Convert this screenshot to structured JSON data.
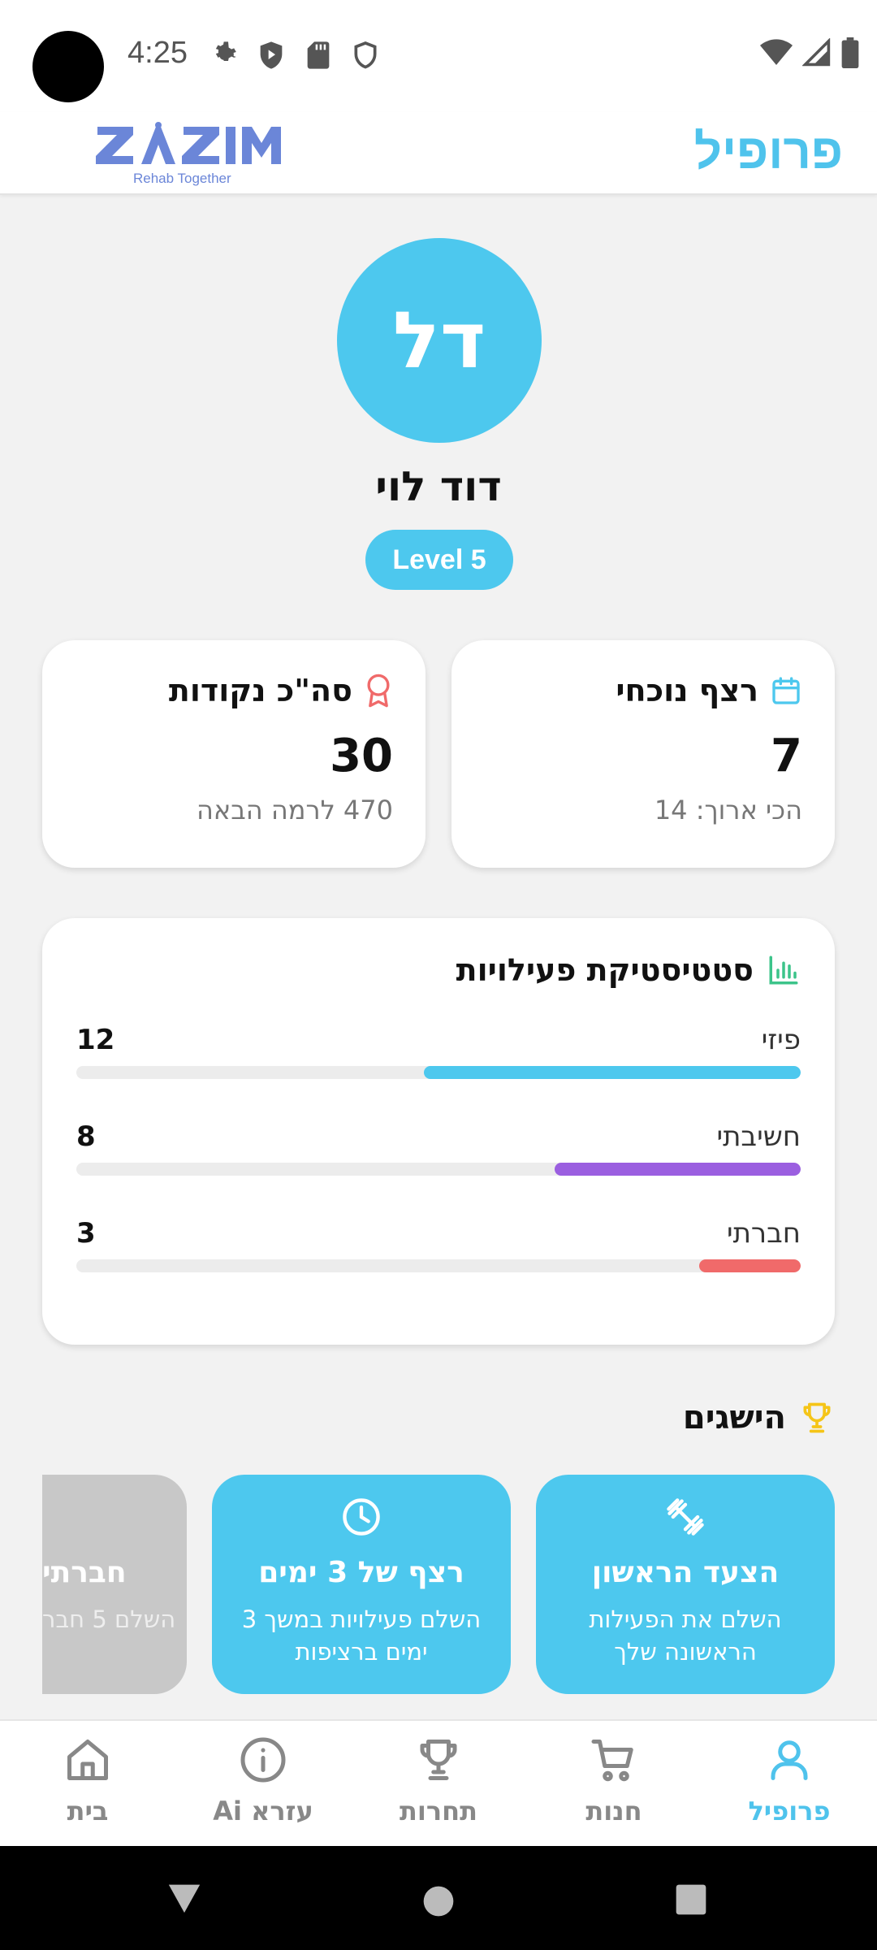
{
  "status_bar": {
    "time": "4:25"
  },
  "header": {
    "logo_text": "ZZIM",
    "logo_subtitle": "Rehab Together",
    "title": "פרופיל"
  },
  "profile": {
    "initials": "דל",
    "name": "דוד לוי",
    "level": "Level 5"
  },
  "stats": {
    "streak": {
      "title": "רצף נוכחי",
      "value": "7",
      "sub": "הכי ארוך: 14"
    },
    "points": {
      "title": "סה\"כ נקודות",
      "value": "30",
      "sub": "470 לרמה הבאה"
    }
  },
  "activity": {
    "title": "סטטיסטיקת פעילויות",
    "rows": [
      {
        "label": "פיזי",
        "count": "12",
        "fraction": 0.52,
        "color": "#4dc8ee"
      },
      {
        "label": "חשיבתי",
        "count": "8",
        "fraction": 0.34,
        "color": "#9b5fe0"
      },
      {
        "label": "חברתי",
        "count": "3",
        "fraction": 0.14,
        "color": "#f06a6a"
      }
    ]
  },
  "achievements": {
    "title": "הישגים",
    "items": [
      {
        "name": "הצעד הראשון",
        "desc": "השלם את הפעילות הראשונה שלך",
        "icon": "dumbbell-icon",
        "locked": false
      },
      {
        "name": "רצף של 3 ימים",
        "desc": "השלם פעילויות במשך 3 ימים ברציפות",
        "icon": "clock-icon",
        "locked": false
      },
      {
        "name": "חברתי",
        "desc": "השלם 5 חבר",
        "icon": "users-icon",
        "locked": true
      }
    ]
  },
  "nav": {
    "home": "בית",
    "ai": "עזרא Ai",
    "competitions": "תחרות",
    "store": "חנות",
    "profile": "פרופיל"
  },
  "colors": {
    "accent": "#4dc8ee",
    "title_blue": "#4fc3ec",
    "logo_blue": "#6b86d8"
  }
}
